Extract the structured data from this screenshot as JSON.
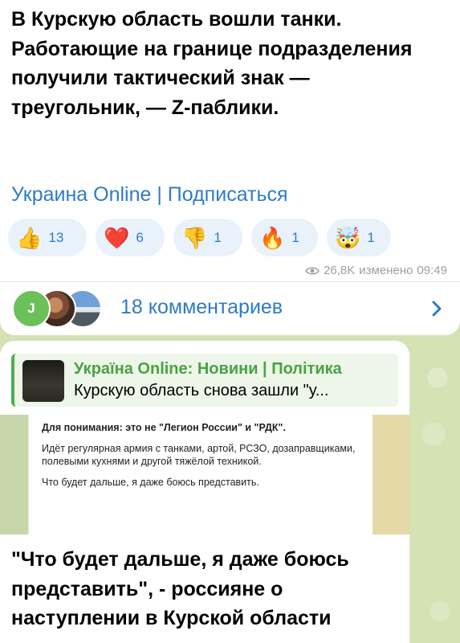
{
  "post": {
    "text": "В Курскую область вошли танки. Работающие на границе подразделения получили тактический знак — треугольник, — Z-паблики.",
    "channel_link": "Украина Online | Подписаться",
    "reactions": [
      {
        "emoji": "👍",
        "icon": "thumbs-up-icon",
        "count": "13"
      },
      {
        "emoji": "❤️",
        "icon": "heart-icon",
        "count": "6"
      },
      {
        "emoji": "👎",
        "icon": "thumbs-down-icon",
        "count": "1"
      },
      {
        "emoji": "🔥",
        "icon": "fire-icon",
        "count": "1"
      },
      {
        "emoji": "🤯",
        "icon": "exploding-head-icon",
        "count": "1"
      }
    ],
    "views": "26,8K",
    "edited_label": "изменено",
    "time": "09:49"
  },
  "comments": {
    "avatar_initial": "J",
    "label": "18 комментариев"
  },
  "forwarded": {
    "reply_title": "Україна Online: Новини | Політика",
    "reply_text": "Курскую область снова зашли \"у...",
    "quote_lines": [
      "Для понимания: это не \"Легион России\" и \"РДК\".",
      "Идёт регулярная армия с танками, артой, РСЗО, дозаправщиками, полевыми кухнями и другой тяжёлой техникой.",
      "Что будет дальше, я даже боюсь представить."
    ],
    "headline": "\"Что будет дальше, я даже боюсь представить\", - россияне о наступлении в Курской области"
  },
  "colors": {
    "link": "#2f7bc6",
    "reaction_bg": "#e9f1fb",
    "reply_accent": "#4fae4e",
    "wallpaper": "#d5e3b4"
  }
}
